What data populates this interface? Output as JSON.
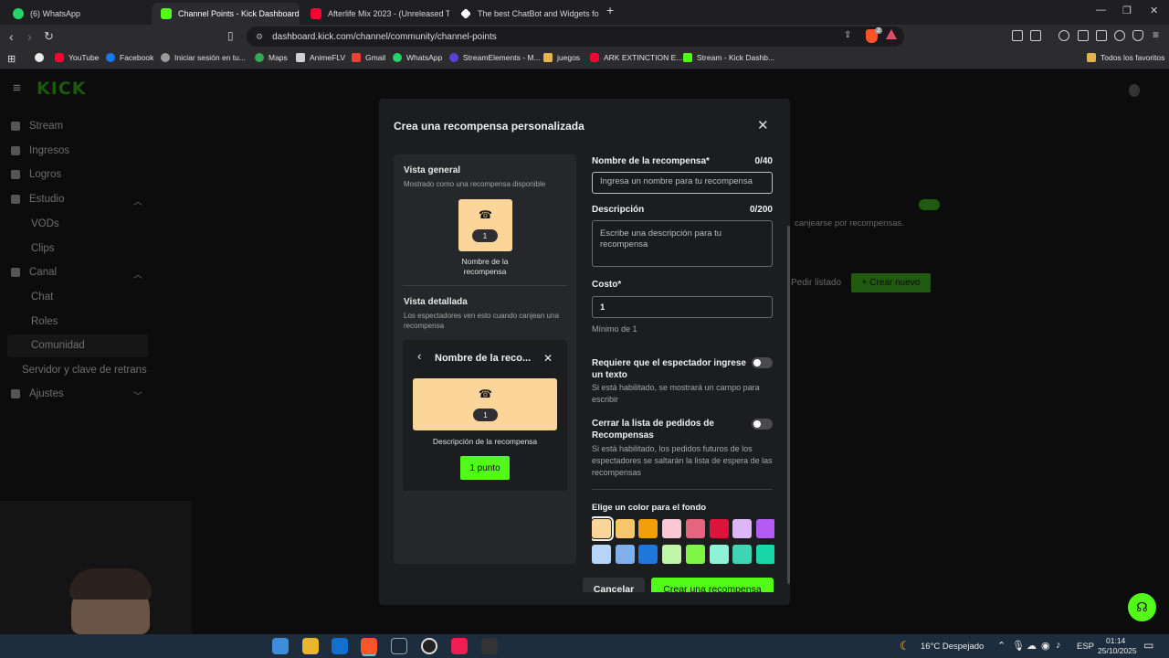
{
  "browser": {
    "tabs": [
      {
        "title": "(6) WhatsApp",
        "color": "#25d366"
      },
      {
        "title": "Channel Points - Kick Dashboard",
        "color": "#53fc18"
      },
      {
        "title": "Afterlife Mix 2023 - (Unreleased T",
        "color": "#ff0033"
      },
      {
        "title": "The best ChatBot and Widgets for Ki",
        "color": "#ffffff"
      }
    ],
    "url": "dashboard.kick.com/channel/community/channel-points",
    "shield_badge": "2",
    "bookmarks": [
      {
        "label": "YouTube",
        "color": "#ff0033"
      },
      {
        "label": "Facebook",
        "color": "#1877f2"
      },
      {
        "label": "Iniciar sesión en tu...",
        "color": "#9a9a9a"
      },
      {
        "label": "Maps",
        "color": "#34a853"
      },
      {
        "label": "AnimeFLV",
        "color": "#d0d0d0"
      },
      {
        "label": "Gmail",
        "color": "#ea4335"
      },
      {
        "label": "WhatsApp",
        "color": "#25d366"
      },
      {
        "label": "StreamElements - M...",
        "color": "#5b3fd9"
      },
      {
        "label": "juegos",
        "color": "#e3b34b"
      },
      {
        "label": "ARK EXTINCTION E...",
        "color": "#ff0033"
      },
      {
        "label": "Stream - Kick Dashb...",
        "color": "#53fc18"
      }
    ],
    "bookmarks_right": "Todos los favoritos"
  },
  "sidebar": {
    "logo": "KICK",
    "items": [
      "Stream",
      "Ingresos",
      "Logros",
      "Estudio",
      "VODs",
      "Clips",
      "Canal",
      "Chat",
      "Roles",
      "Comunidad",
      "Servidor y clave de retrans",
      "Ajustes"
    ]
  },
  "background_page": {
    "text": "canjearse por recompensas.",
    "edit_link": "Pedir listado",
    "create_button": "+ Crear nuevo"
  },
  "modal": {
    "title": "Crea una recompensa personalizada",
    "preview": {
      "overview_heading": "Vista general",
      "overview_sub": "Mostrado como una recompensa disponible",
      "tile_cost": "1",
      "tile_name": "Nombre de la recompensa",
      "detail_heading": "Vista detallada",
      "detail_sub": "Los espectadores ven esto cuando canjean una recompensa",
      "detail_title": "Nombre de la reco...",
      "detail_cost": "1",
      "detail_desc": "Descripción de la recompensa",
      "points_button": "1 punto"
    },
    "form": {
      "name_label": "Nombre de la recompensa*",
      "name_count": "0/40",
      "name_placeholder": "Ingresa un nombre para tu recompensa",
      "desc_label": "Descripción",
      "desc_count": "0/200",
      "desc_placeholder": "Escribe una descripción para tu recompensa",
      "cost_label": "Costo*",
      "cost_value": "1",
      "cost_hint": "Mínimo de 1",
      "require_text_label": "Requiere que el espectador ingrese un texto",
      "require_text_hint": "Si está habilitado, se mostrará un campo para escribir",
      "close_list_label": "Cerrar la lista de pedidos de Recompensas",
      "close_list_hint": "Si está habilitado, los pedidos futuros de los espectadores se saltarán la lista de espera de las recompensas",
      "color_label": "Elige un color para el fondo",
      "colors": [
        "#fcd59a",
        "#f7c66b",
        "#f59e0b",
        "#f9c6d3",
        "#e5647f",
        "#dc143c",
        "#dcb6f7",
        "#b35cf5",
        "#b6d4f5",
        "#7fb0ec",
        "#1e78dc",
        "#bff5a8",
        "#7cf544",
        "#8ef2d6",
        "#3ed5b5",
        "#19d7a8"
      ],
      "selected_color": 0,
      "cancel_button": "Cancelar",
      "create_button": "Crear una recompensa"
    }
  },
  "taskbar": {
    "weather": "16°C  Despejado",
    "lang": "ESP",
    "time": "01:14",
    "date": "25/10/2025"
  }
}
